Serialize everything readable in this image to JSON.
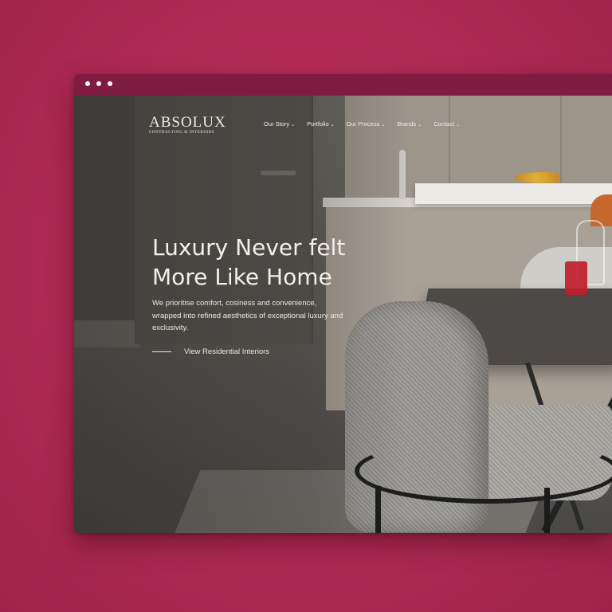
{
  "browser": {
    "window_dots": [
      "dot",
      "dot",
      "dot"
    ]
  },
  "brand": {
    "logo_text": "ABSOLUX",
    "tagline": "CONTRACTING & INTERIORS"
  },
  "nav": {
    "items": [
      {
        "label": "Our Story"
      },
      {
        "label": "Portfolio"
      },
      {
        "label": "Our Process"
      },
      {
        "label": "Brands"
      },
      {
        "label": "Contact"
      }
    ],
    "chevron": "⌄"
  },
  "hero": {
    "headline_line1": "Luxury Never felt",
    "headline_line2": "More Like Home",
    "subtext": "We prioritise comfort, cosiness and convenience, wrapped into refined aesthetics of exceptional luxury and exclusivity.",
    "cta_label": "View Residential Interiors"
  },
  "colors": {
    "background": "#b02a56",
    "browser_bar": "#7e1d40",
    "text": "#f3efe7"
  }
}
